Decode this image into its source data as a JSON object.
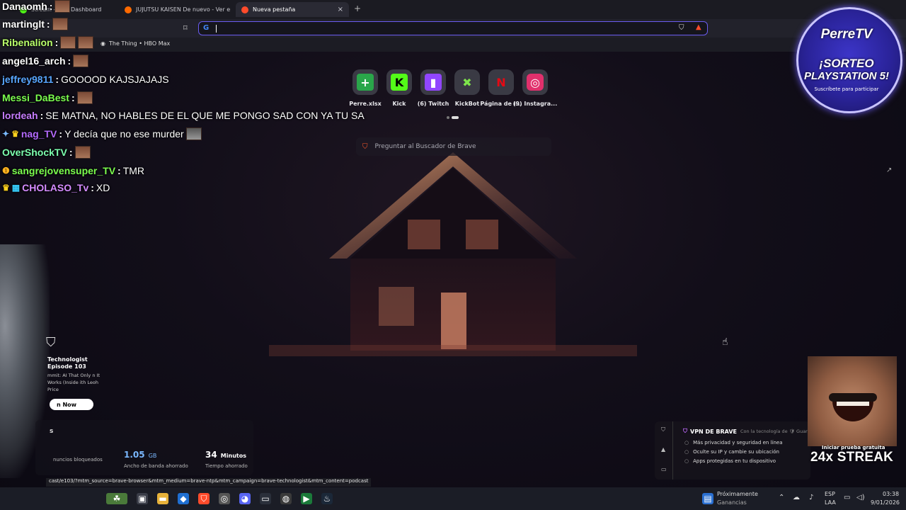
{
  "tabs": [
    {
      "label": "Stream - Kick Dashboard",
      "active": false,
      "color": "#53fc18"
    },
    {
      "label": "JUJUTSU KAISEN De nuevo - Ver en C",
      "active": false,
      "color": "#ff6a00"
    },
    {
      "label": "Nueva pestaña",
      "active": true,
      "color": "#ff4b2b"
    }
  ],
  "bookmarks": [
    {
      "label": "The Thing • HBO Max"
    }
  ],
  "shortcuts": [
    {
      "label": "Perre.xlsx",
      "icon": "plus-icon",
      "glyph": "+",
      "bg": "#2aa64a"
    },
    {
      "label": "Kick",
      "icon": "kick-icon",
      "glyph": "K",
      "bg": "#53fc18"
    },
    {
      "label": "(6) Twitch",
      "icon": "twitch-icon",
      "glyph": "▮",
      "bg": "#9146ff"
    },
    {
      "label": "KickBot",
      "icon": "kickbot-icon",
      "glyph": "✖",
      "bg": "#7ee64b"
    },
    {
      "label": "Página de i...",
      "icon": "netflix-icon",
      "glyph": "N",
      "bg": "#e50914"
    },
    {
      "label": "(9) Instagra...",
      "icon": "instagram-icon",
      "glyph": "◎",
      "bg": "#e1306c"
    }
  ],
  "search": {
    "ask_placeholder": "Preguntar al Buscador de Brave"
  },
  "chat": [
    {
      "user": "Danaomh",
      "color": "#ffffff",
      "text": ""
    },
    {
      "user": "martinglt",
      "color": "#ffffff",
      "text": ""
    },
    {
      "user": "Ribenalion",
      "color": "#b9ff6b",
      "text": ""
    },
    {
      "user": "angel16_arch",
      "color": "#ffffff",
      "text": ""
    },
    {
      "user": "jeffrey9811",
      "color": "#58a6ff",
      "text": "GOOOOD KAJSJAJAJS"
    },
    {
      "user": "Messi_DaBest",
      "color": "#7cff4f",
      "text": ""
    },
    {
      "user": "lordeah",
      "color": "#c77dff",
      "text": "SE MATNA, NO HABLES DE EL QUE ME PONGO SAD CON YA TU SA"
    },
    {
      "user": "nag_TV",
      "color": "#b56bff",
      "text": "Y decía que no ese murder"
    },
    {
      "user": "OverShockTV",
      "color": "#7dffb0",
      "text": ""
    },
    {
      "user": "sangrejovensuper_TV",
      "color": "#7cff4f",
      "text": "TMR"
    },
    {
      "user": "CHOLASO_Tv",
      "color": "#d58cff",
      "text": "XD"
    }
  ],
  "promo": {
    "title1": "Technologist",
    "title2": "Episode 103",
    "desc": "mmit: AI That Only n It Works (Inside ith Leoh Price",
    "button": "n Now"
  },
  "stats": {
    "heading": "s",
    "items": [
      {
        "value": "",
        "unit": "",
        "caption": "nuncios bloqueados"
      },
      {
        "value": "1.05",
        "unit": "GB",
        "caption": "Ancho de banda ahorrado"
      },
      {
        "value": "34",
        "unit": "Minutos",
        "caption": "Tiempo ahorrado"
      }
    ]
  },
  "status_url": "cast/e103/?mtm_source=brave-browser&mtm_medium=brave-ntp&mtm_campaign=brave-technologist&mtm_content=podcast",
  "vpn": {
    "title": "VPN DE BRAVE",
    "powered": "Con la tecnología de 🛡 Guard",
    "bullets": [
      "Más privacidad y seguridad en línea",
      "Oculte su IP y cambie su ubicación",
      "Apps protegidas en tu dispositivo"
    ]
  },
  "overlay": {
    "brand": "PerreTV",
    "line1": "¡SORTEO",
    "line2": "PLAYSTATION 5!",
    "line3": "Suscríbete para participar",
    "streak_small": "Iniciar prueba gratuita",
    "streak": "24x STREAK"
  },
  "taskbar": {
    "widget_title": "Próximamente",
    "widget_sub": "Ganancias",
    "lang1": "ESP",
    "lang2": "LAA",
    "time": "03:38",
    "date": "9/01/2026"
  }
}
